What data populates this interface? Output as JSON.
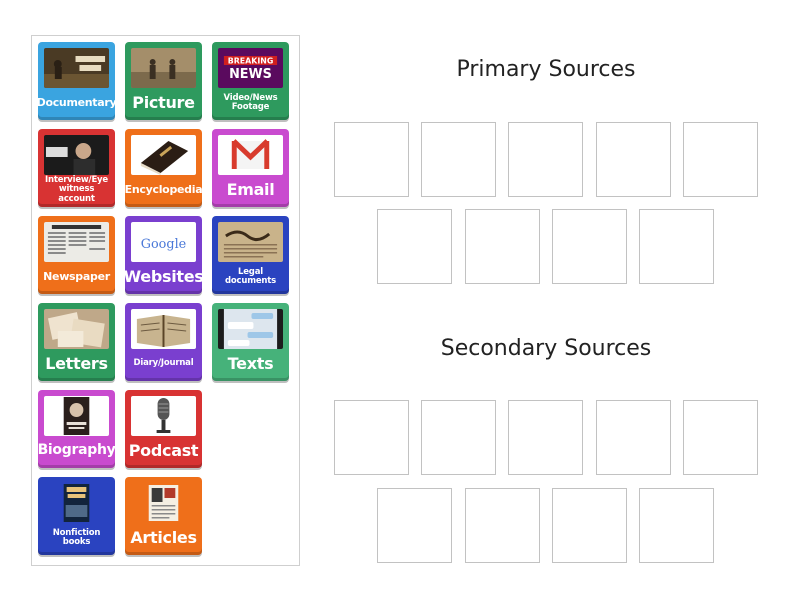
{
  "cards": [
    {
      "label": "Documentary",
      "image": "world-war-ii-icon"
    },
    {
      "label": "Picture",
      "image": "soldiers-photo-icon"
    },
    {
      "label": "Video/News Footage",
      "image": "breaking-news-icon",
      "image_text": [
        "BREAKING",
        "NEWS"
      ]
    },
    {
      "label": "Interview/Eye witness account",
      "image": "interview-icon"
    },
    {
      "label": "Encyclopedia",
      "image": "book-icon"
    },
    {
      "label": "Email",
      "image": "gmail-icon"
    },
    {
      "label": "Newspaper",
      "image": "newspaper-icon"
    },
    {
      "label": "Websites",
      "image": "google-icon",
      "image_text": [
        "Google"
      ]
    },
    {
      "label": "Legal documents",
      "image": "we-the-people-icon"
    },
    {
      "label": "Letters",
      "image": "letters-icon"
    },
    {
      "label": "Diary/Journal",
      "image": "diary-icon"
    },
    {
      "label": "Texts",
      "image": "text-messages-icon"
    },
    {
      "label": "Biography",
      "image": "einstein-book-icon"
    },
    {
      "label": "Podcast",
      "image": "microphone-icon"
    },
    {
      "label": "Nonfiction books",
      "image": "titanic-book-icon"
    },
    {
      "label": "Articles",
      "image": "magazine-icon"
    }
  ],
  "groups": [
    {
      "title": "Primary Sources",
      "slots": 9
    },
    {
      "title": "Secondary Sources",
      "slots": 9
    }
  ],
  "colors": {
    "blue": "#3aa4e0",
    "green": "#2e9a5e",
    "red": "#d83333",
    "orange": "#ef6f1a",
    "magenta": "#c94bcf",
    "purple": "#7a3fcf",
    "navy": "#2a43c0",
    "slot_border": "#c2c2c2"
  }
}
